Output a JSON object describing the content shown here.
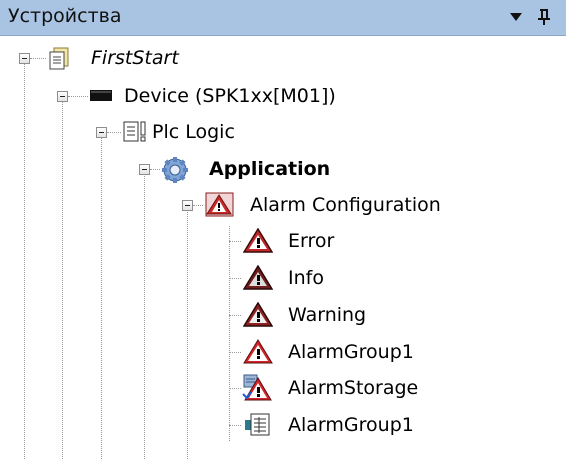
{
  "panel": {
    "title": "Устройства",
    "dropdown_icon": "triangle-down",
    "pin_icon": "pin-icon"
  },
  "tree": {
    "project": {
      "label": "FirstStart",
      "icon": "project-document-icon"
    },
    "device": {
      "label": "Device (SPK1xx[M01])",
      "icon": "device-icon"
    },
    "plc_logic": {
      "label": "Plc Logic",
      "icon": "plc-logic-icon"
    },
    "application": {
      "label": "Application",
      "icon": "application-gear-icon"
    },
    "alarm_configuration": {
      "label": "Alarm Configuration",
      "icon": "alarm-configuration-icon"
    },
    "children": [
      {
        "label": "Error",
        "icon": "alarm-class-error-icon",
        "color": "#c0282b"
      },
      {
        "label": "Info",
        "icon": "alarm-class-info-icon",
        "color": "#7a2222"
      },
      {
        "label": "Warning",
        "icon": "alarm-class-warning-icon",
        "color": "#9a2020"
      },
      {
        "label": "AlarmGroup1",
        "icon": "alarm-group-icon",
        "color": "#d2262b"
      },
      {
        "label": "AlarmStorage",
        "icon": "alarm-storage-icon",
        "color": "#d2262b"
      },
      {
        "label": "AlarmGroup1",
        "icon": "alarm-table-icon",
        "color": "#2a7a8c"
      }
    ]
  }
}
